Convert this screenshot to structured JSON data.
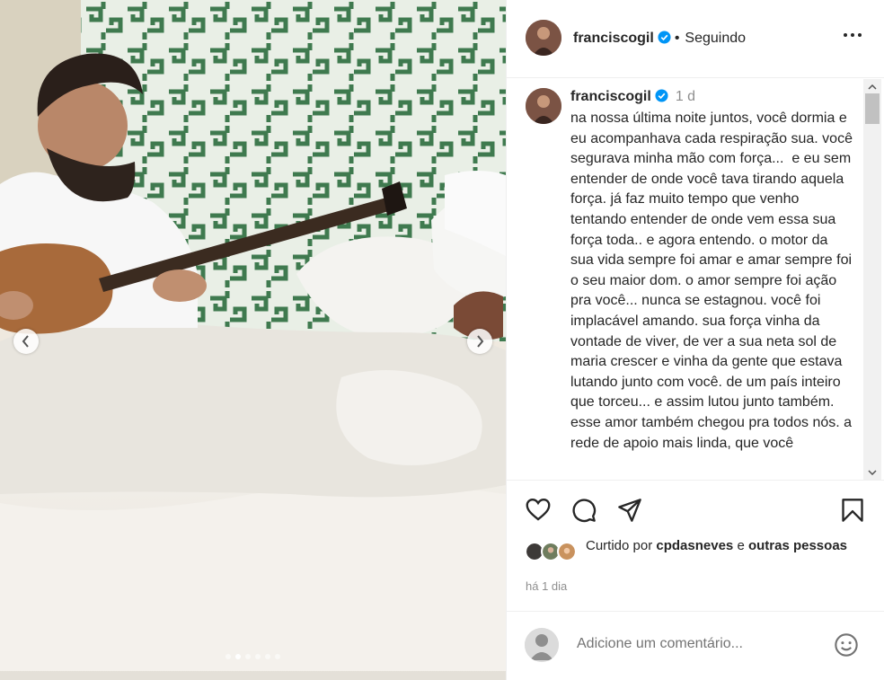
{
  "post": {
    "username": "franciscogil",
    "follow_status": "Seguindo",
    "separator": "•",
    "caption_age": "1 d",
    "caption": "na nossa última noite juntos, você dormia e eu acompanhava cada respiração sua. você segurava minha mão com força...  e eu sem entender de onde você tava tirando aquela força. já faz muito tempo que venho tentando entender de onde vem essa sua força toda.. e agora entendo. o motor da sua vida sempre foi amar e amar sempre foi o seu maior dom. o amor sempre foi ação pra você... nunca se estagnou. você foi implacável amando. sua força vinha da vontade de viver, de ver a sua neta sol de maria crescer e vinha da gente que estava lutando junto com você. de um país inteiro que torceu... e assim lutou junto também. esse amor também chegou pra todos nós. a rede de apoio mais linda, que você",
    "likes": {
      "prefix": "Curtido por",
      "user": "cpdasneves",
      "conj": "e",
      "others": "outras pessoas"
    },
    "posted": "há 1 dia",
    "comment_placeholder": "Adicione um comentário..."
  },
  "carousel": {
    "count": 6,
    "active_index": 1
  },
  "icons": {
    "verified": "verified-badge-icon",
    "more": "more-options-icon",
    "like": "heart-icon",
    "comment": "comment-icon",
    "share": "share-icon",
    "save": "bookmark-icon",
    "emoji": "emoji-icon",
    "prev": "chevron-left-icon",
    "next": "chevron-right-icon"
  },
  "colors": {
    "verified": "#0095f6",
    "wallpaper": "#3f7a4f"
  }
}
